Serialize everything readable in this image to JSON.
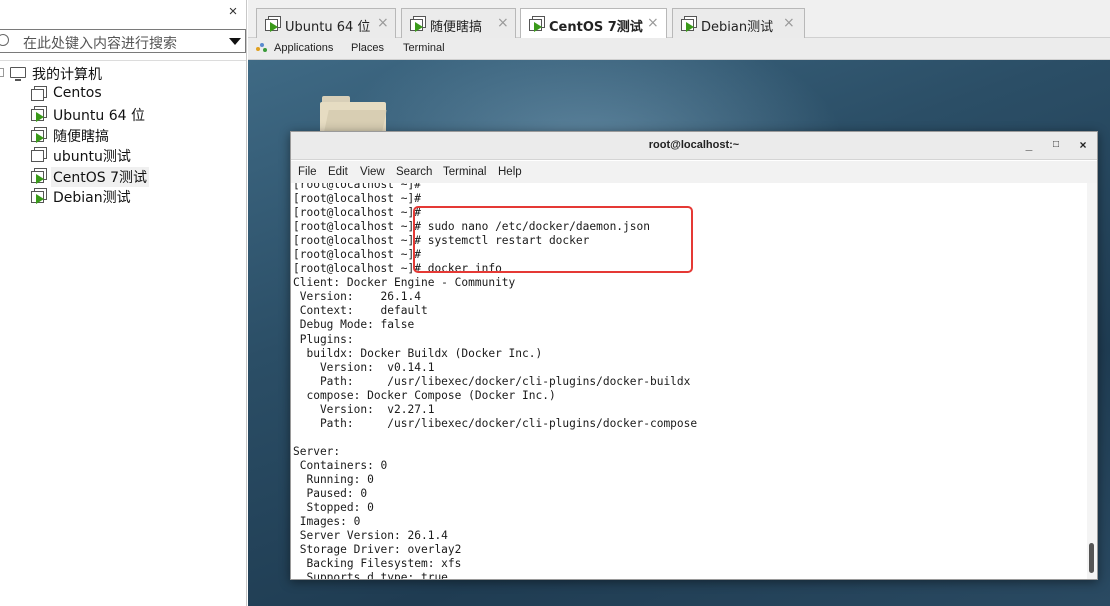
{
  "library": {
    "close_glyph": "×",
    "search_placeholder": "在此处键入内容进行搜索",
    "root_label": "我的计算机",
    "vms": [
      {
        "label": "Centos",
        "running": false
      },
      {
        "label": "Ubuntu 64 位",
        "running": true
      },
      {
        "label": "随便瞎搞",
        "running": true
      },
      {
        "label": "ubuntu测试",
        "running": false
      },
      {
        "label": "CentOS 7测试",
        "running": true,
        "selected": true
      },
      {
        "label": "Debian测试",
        "running": true
      }
    ]
  },
  "tabs": [
    {
      "label": "Ubuntu 64 位",
      "active": false
    },
    {
      "label": "随便瞎搞",
      "active": false
    },
    {
      "label": "CentOS 7测试",
      "active": true
    },
    {
      "label": "Debian测试",
      "active": false
    }
  ],
  "tab_close_glyph": "×",
  "gnome_bar": {
    "applications": "Applications",
    "places": "Places",
    "terminal": "Terminal"
  },
  "terminal": {
    "title": "root@localhost:~",
    "minimize": "_",
    "maximize": "□",
    "close": "×",
    "menu": [
      "File",
      "Edit",
      "View",
      "Search",
      "Terminal",
      "Help"
    ],
    "lines": [
      "[root@localhost ~]#",
      "[root@localhost ~]#",
      "[root@localhost ~]#",
      "[root@localhost ~]# sudo nano /etc/docker/daemon.json",
      "[root@localhost ~]# systemctl restart docker",
      "[root@localhost ~]#",
      "[root@localhost ~]# docker info",
      "Client: Docker Engine - Community",
      " Version:    26.1.4",
      " Context:    default",
      " Debug Mode: false",
      " Plugins:",
      "  buildx: Docker Buildx (Docker Inc.)",
      "    Version:  v0.14.1",
      "    Path:     /usr/libexec/docker/cli-plugins/docker-buildx",
      "  compose: Docker Compose (Docker Inc.)",
      "    Version:  v2.27.1",
      "    Path:     /usr/libexec/docker/cli-plugins/docker-compose",
      "",
      "Server:",
      " Containers: 0",
      "  Running: 0",
      "  Paused: 0",
      "  Stopped: 0",
      " Images: 0",
      " Server Version: 26.1.4",
      " Storage Driver: overlay2",
      "  Backing Filesystem: xfs",
      "  Supports d_type: true"
    ]
  },
  "colors": {
    "highlight": "#e53935",
    "running": "#3a9a1a"
  }
}
